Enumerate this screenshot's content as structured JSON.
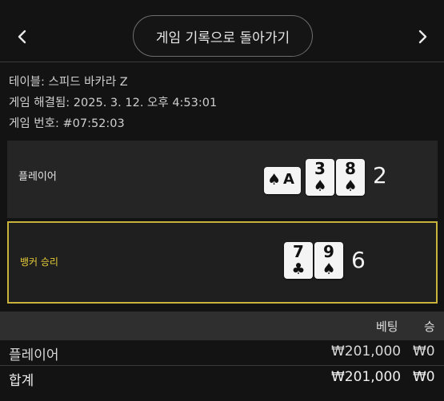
{
  "header": {
    "back_label": "게임 기록으로 돌아가기"
  },
  "info": {
    "table": "테이블: 스피드 바카라 Z",
    "resolved": "게임 해결됨: 2025. 3. 12. 오후 4:53:01",
    "round": "게임 번호: #07:52:03"
  },
  "player_hand": {
    "label": "플레이어",
    "score": "2",
    "cards": [
      {
        "rank": "A",
        "suit": "♠",
        "orientation": "sideways"
      },
      {
        "rank": "3",
        "suit": "♠"
      },
      {
        "rank": "8",
        "suit": "♠"
      }
    ]
  },
  "banker_hand": {
    "label": "뱅커 승리",
    "score": "6",
    "highlight_color": "#c9b23c",
    "cards": [
      {
        "rank": "7",
        "suit": "♣"
      },
      {
        "rank": "9",
        "suit": "♠"
      }
    ]
  },
  "bets_table": {
    "columns": [
      "베팅",
      "승"
    ],
    "rows": [
      {
        "name": "플레이어",
        "bet": "₩201,000",
        "win": "₩0"
      },
      {
        "name": "합계",
        "bet": "₩201,000",
        "win": "₩0"
      }
    ]
  }
}
